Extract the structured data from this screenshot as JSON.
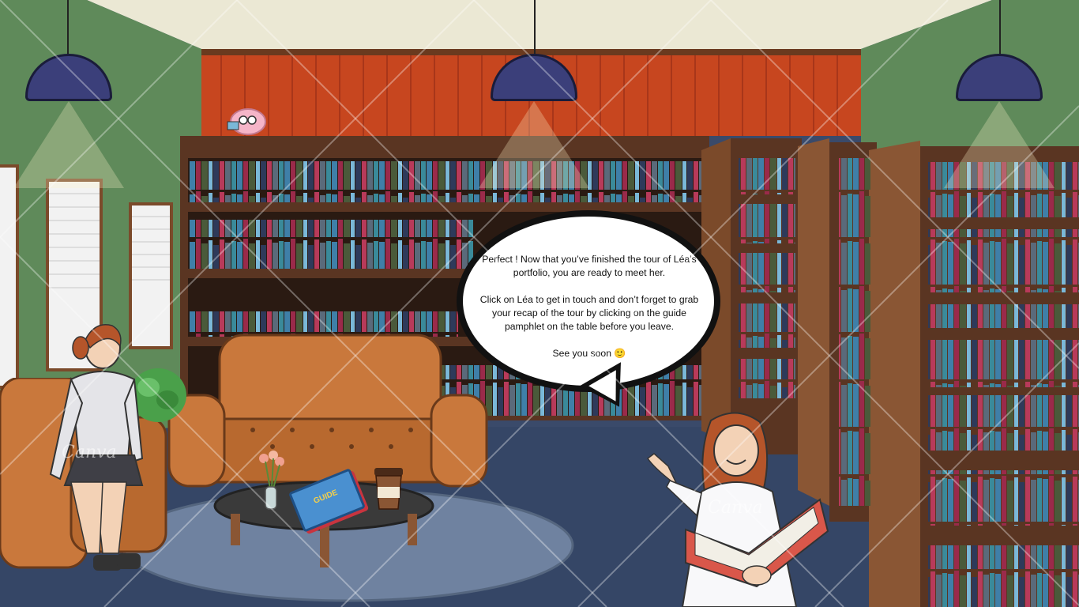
{
  "speech_bubble": {
    "line1": "Perfect ! Now that you’ve finished the tour of Léa’s portfolio, you are ready to meet her.",
    "line2": "Click on Léa to get in touch and don’t forget to grab your recap of the tour by clicking on the guide pamphlet on the table before you leave.",
    "line3": "See you soon 🙂"
  },
  "pamphlet": {
    "label": "GUIDE"
  },
  "watermarks": [
    "Canva",
    "Canva"
  ],
  "colors": {
    "wall_green": "#5f8a5a",
    "ceiling": "#ebe8d4",
    "back_wall": "#c7461f",
    "shelf_wood": "#5a3522",
    "carpet": "#6f82a0",
    "floor": "#354666",
    "sofa": "#c9783c",
    "lamp_shade": "#3b3f7a"
  }
}
